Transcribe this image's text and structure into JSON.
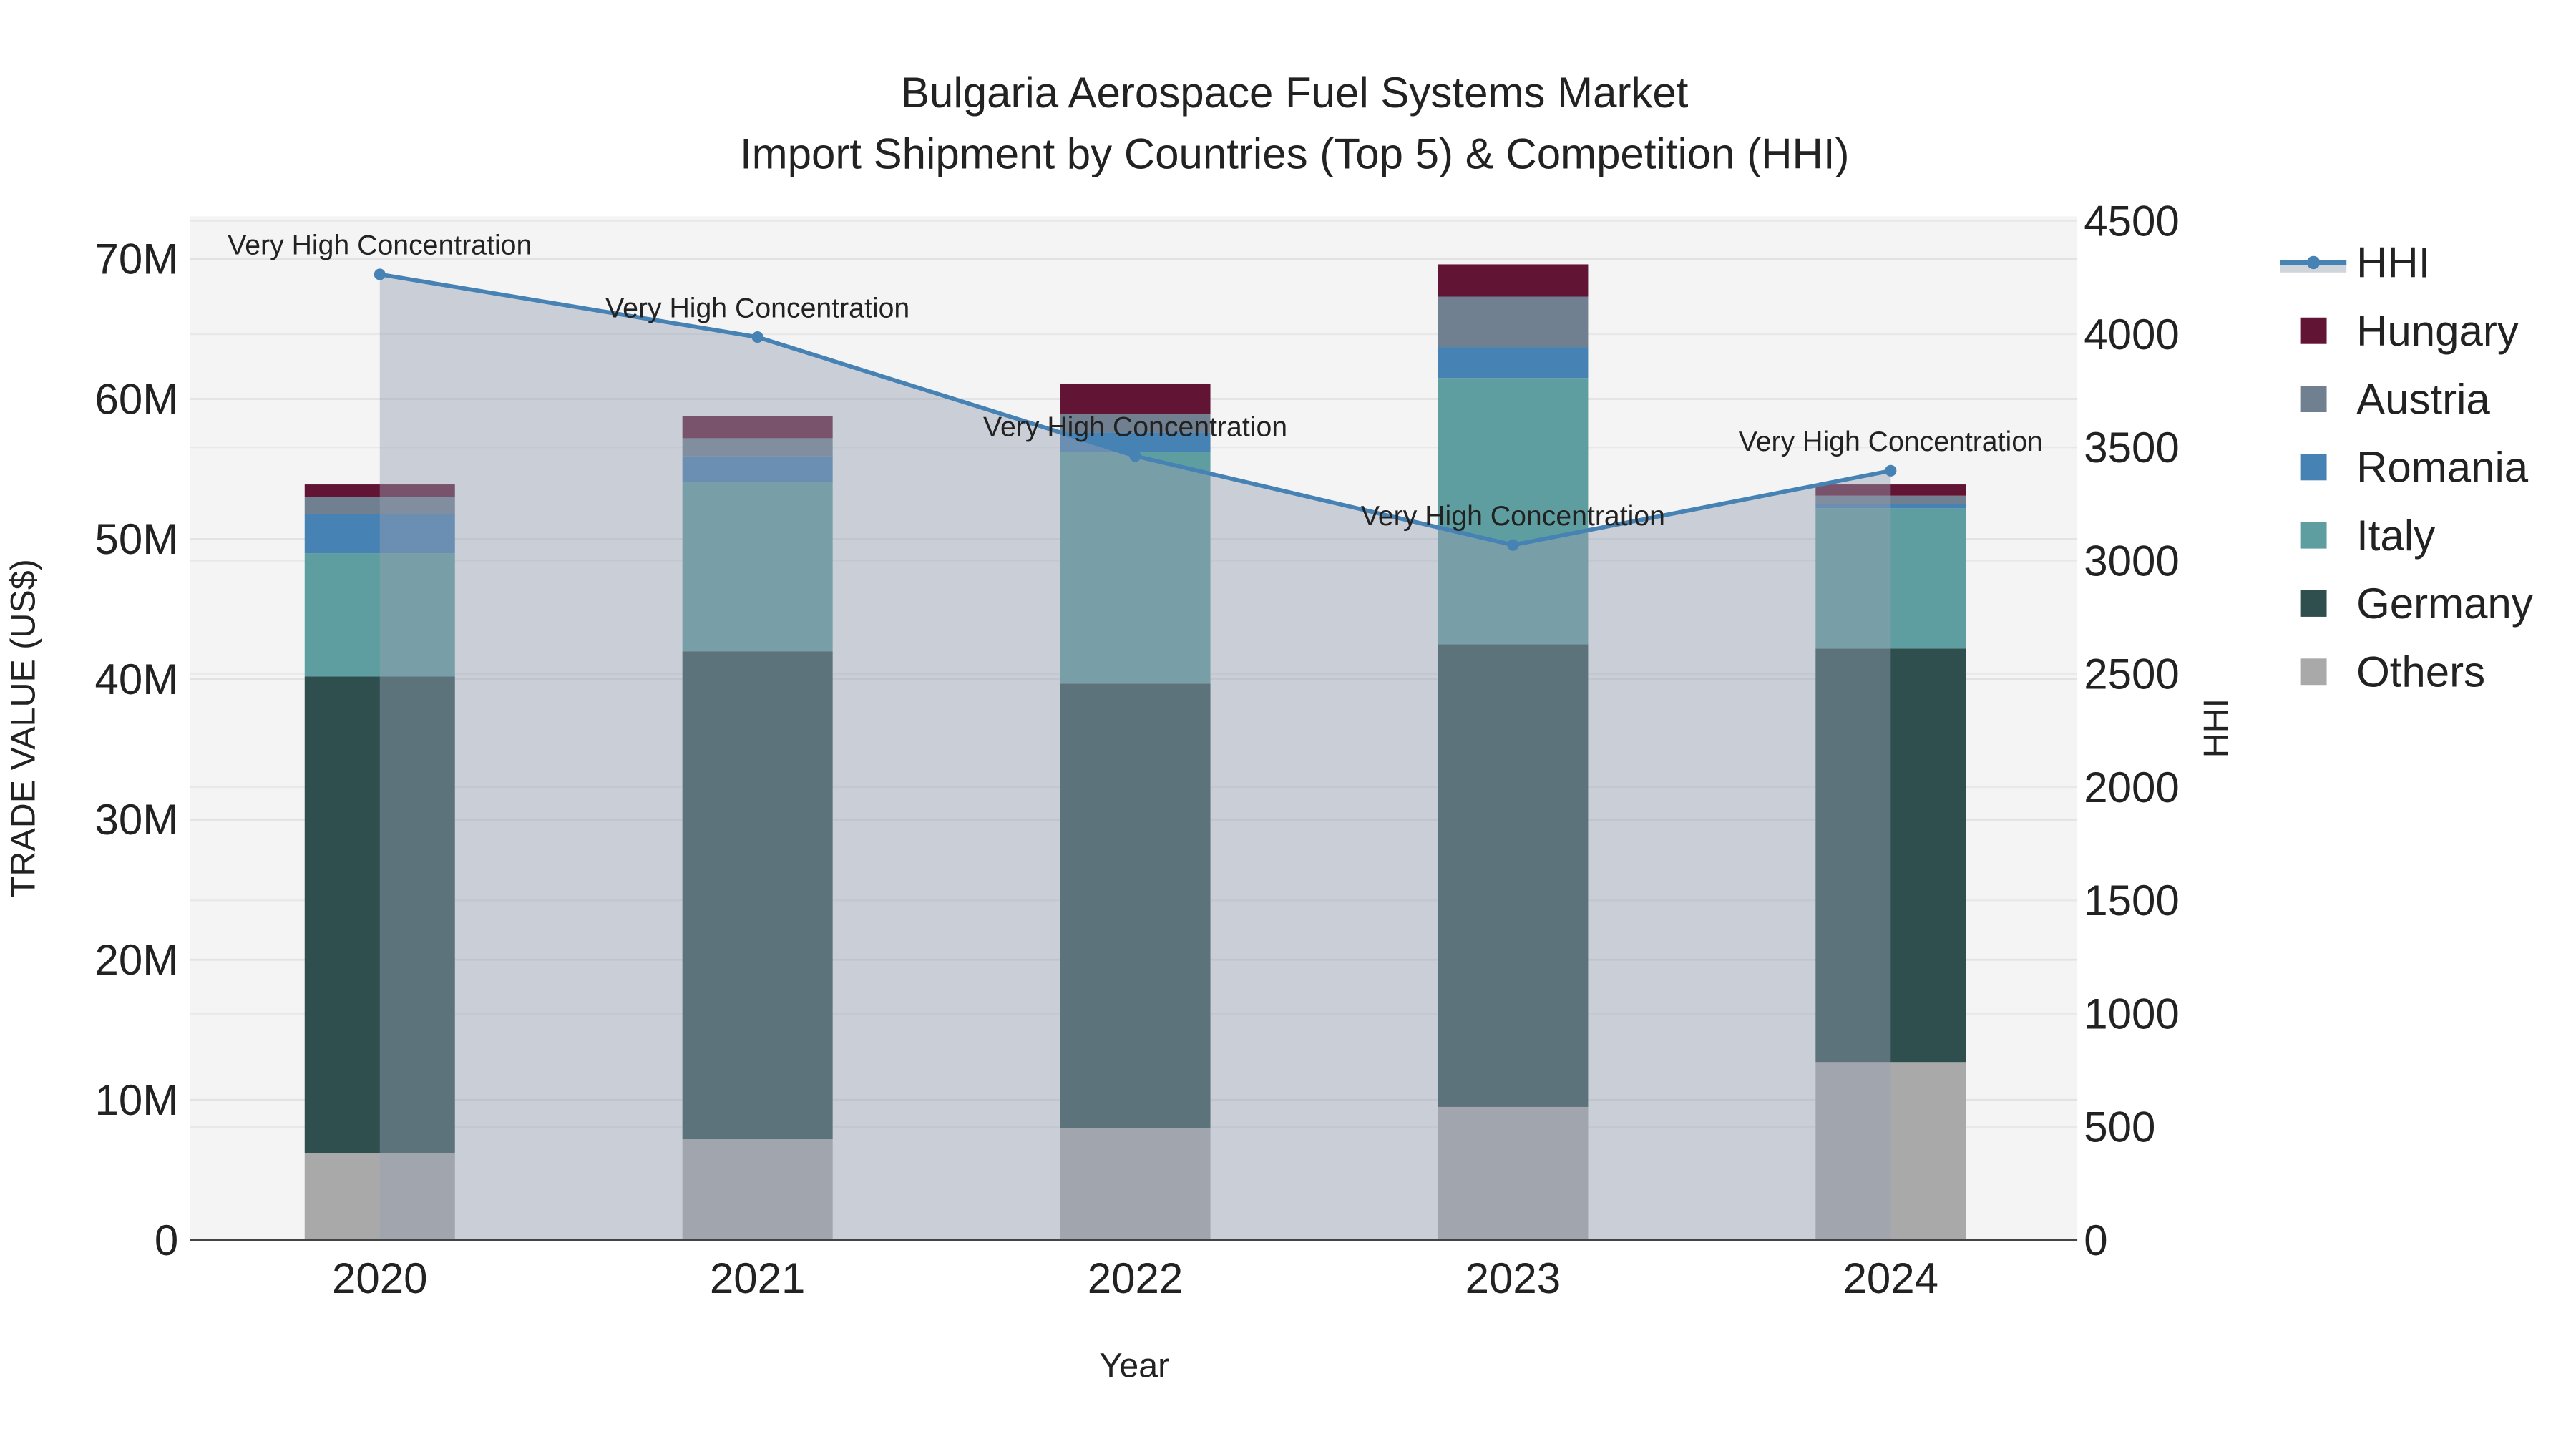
{
  "chart_data": {
    "type": "bar",
    "title": "Bulgaria Aerospace Fuel Systems Market",
    "subtitle": "Import Shipment by Countries (Top 5) & Competition (HHI)",
    "xlabel": "Year",
    "ylabel": "TRADE VALUE (US$)",
    "y2label": "HHI",
    "categories": [
      "2020",
      "2021",
      "2022",
      "2023",
      "2024"
    ],
    "ylim": [
      0,
      73000000
    ],
    "y2lim": [
      0,
      4600
    ],
    "yticks": [
      0,
      10000000,
      20000000,
      30000000,
      40000000,
      50000000,
      60000000,
      70000000
    ],
    "ytick_labels": [
      "0",
      "10M",
      "20M",
      "30M",
      "40M",
      "50M",
      "60M",
      "70M"
    ],
    "y2ticks": [
      0,
      500,
      1000,
      1500,
      2000,
      2500,
      3000,
      3500,
      4000,
      4500
    ],
    "y2tick_labels": [
      "0",
      "500",
      "1000",
      "1500",
      "2000",
      "2500",
      "3000",
      "3500",
      "4000",
      "4500"
    ],
    "grid": true,
    "legend_position": "right",
    "stack_series": [
      {
        "name": "Others",
        "color": "#a9a9a9",
        "values": [
          6200000,
          7200000,
          8000000,
          9500000,
          12700000
        ]
      },
      {
        "name": "Germany",
        "color": "#2f4f4f",
        "values": [
          34000000,
          34800000,
          31700000,
          33000000,
          29500000
        ]
      },
      {
        "name": "Italy",
        "color": "#5f9ea0",
        "values": [
          8800000,
          12100000,
          16500000,
          19000000,
          10000000
        ]
      },
      {
        "name": "Romania",
        "color": "#4682b4",
        "values": [
          2800000,
          1800000,
          1400000,
          2200000,
          300000
        ]
      },
      {
        "name": "Austria",
        "color": "#708090",
        "values": [
          1200000,
          1300000,
          1300000,
          3600000,
          600000
        ]
      },
      {
        "name": "Hungary",
        "color": "#621434",
        "values": [
          900000,
          1600000,
          2200000,
          2300000,
          800000
        ]
      }
    ],
    "line_series": {
      "name": "HHI",
      "color": "#4682b4",
      "fill": "to-zero",
      "values": [
        4264,
        3987,
        3462,
        3069,
        3397
      ],
      "annotations": [
        "Very High Concentration",
        "Very High Concentration",
        "Very High Concentration",
        "Very High Concentration",
        "Very High Concentration"
      ]
    },
    "legend_order": [
      "HHI",
      "Hungary",
      "Austria",
      "Romania",
      "Italy",
      "Germany",
      "Others"
    ]
  }
}
